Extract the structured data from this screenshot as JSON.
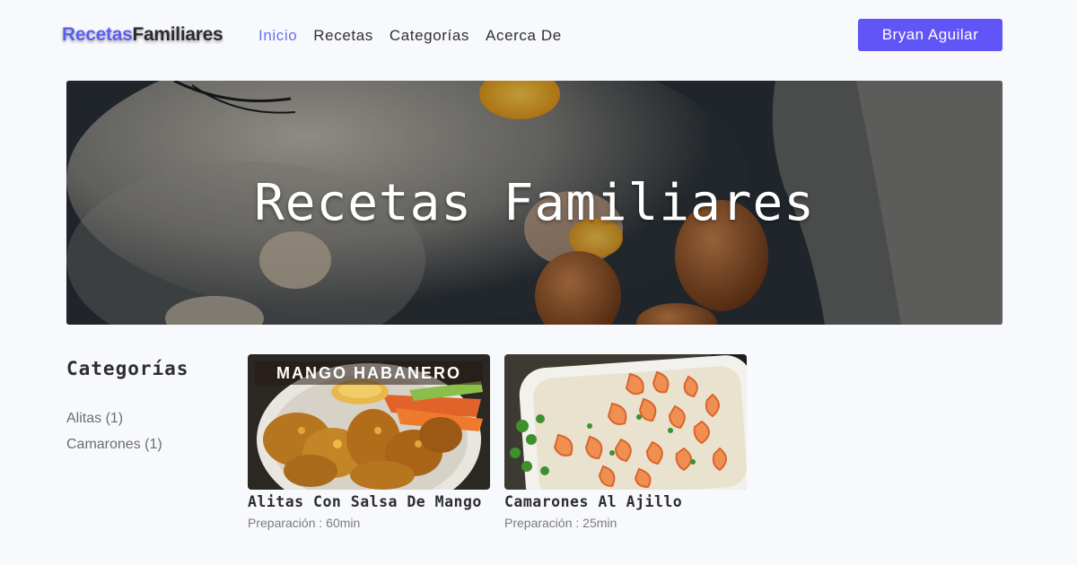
{
  "brand": {
    "part1": "Recetas",
    "part2": "Familiares"
  },
  "nav": {
    "links": [
      {
        "label": "Inicio",
        "active": true
      },
      {
        "label": "Recetas",
        "active": false
      },
      {
        "label": "Categorías",
        "active": false
      },
      {
        "label": "Acerca De",
        "active": false
      }
    ],
    "user_button": "Bryan Aguilar"
  },
  "hero": {
    "title": "Recetas Familiares"
  },
  "sidebar": {
    "heading": "Categorías",
    "items": [
      "Alitas (1)",
      "Camarones (1)"
    ]
  },
  "recipes": [
    {
      "title": "Alitas Con Salsa De Mango",
      "prep": "Preparación : 60min",
      "image_banner": "MANGO HABANERO"
    },
    {
      "title": "Camarones Al Ajillo",
      "prep": "Preparación : 25min"
    }
  ],
  "colors": {
    "accent": "#6055f6",
    "brand_accent": "#5b5ff0",
    "active_link": "#6a6ef2",
    "background": "#f8f9fc"
  },
  "icons": {
    "hero_image": "eggs-and-flour-photo",
    "recipe_1_image": "chicken-wings-photo",
    "recipe_2_image": "garlic-shrimp-photo"
  }
}
